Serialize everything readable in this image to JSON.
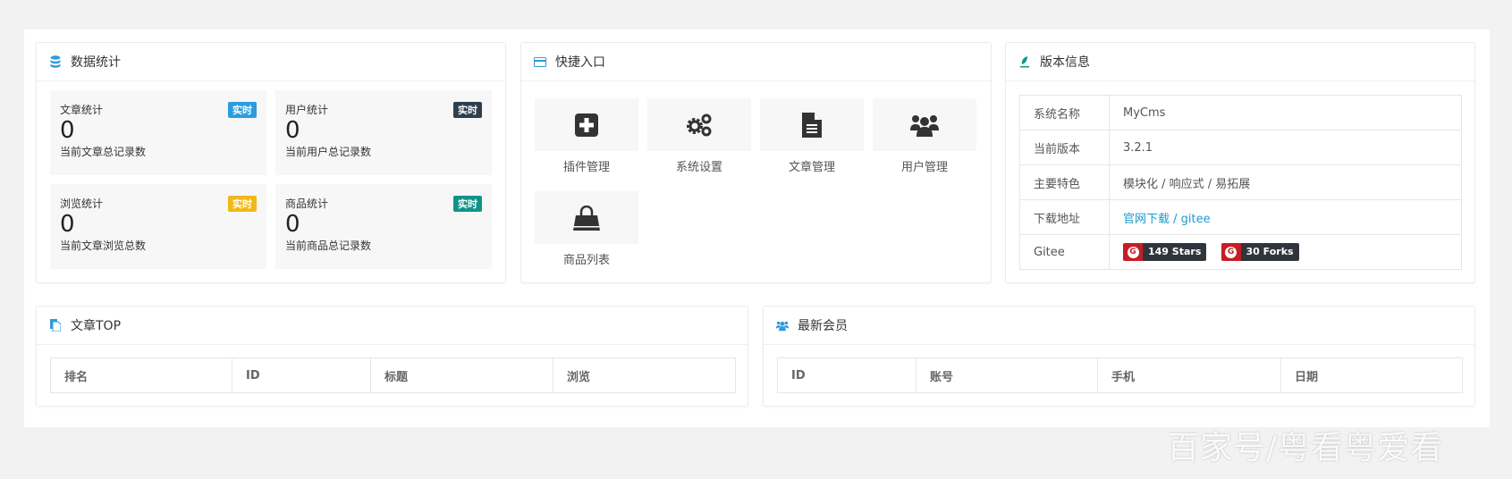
{
  "stats_card": {
    "title": "数据统计",
    "items": [
      {
        "title": "文章统计",
        "badge": "实时",
        "badge_color": "#2d9cdb",
        "value": "0",
        "desc": "当前文章总记录数"
      },
      {
        "title": "用户统计",
        "badge": "实时",
        "badge_color": "#2f3f50",
        "value": "0",
        "desc": "当前用户总记录数"
      },
      {
        "title": "浏览统计",
        "badge": "实时",
        "badge_color": "#f1b81a",
        "value": "0",
        "desc": "当前文章浏览总数"
      },
      {
        "title": "商品统计",
        "badge": "实时",
        "badge_color": "#119488",
        "value": "0",
        "desc": "当前商品总记录数"
      }
    ]
  },
  "quick_card": {
    "title": "快捷入口",
    "items": [
      {
        "label": "插件管理",
        "icon": "plus-square-icon"
      },
      {
        "label": "系统设置",
        "icon": "gears-icon"
      },
      {
        "label": "文章管理",
        "icon": "file-text-icon"
      },
      {
        "label": "用户管理",
        "icon": "users-icon"
      },
      {
        "label": "商品列表",
        "icon": "shopping-bag-icon"
      }
    ]
  },
  "version_card": {
    "title": "版本信息",
    "rows": [
      {
        "label": "系统名称",
        "value": "MyCms"
      },
      {
        "label": "当前版本",
        "value": "3.2.1"
      },
      {
        "label": "主要特色",
        "value": "模块化 / 响应式 / 易拓展"
      },
      {
        "label": "下载地址",
        "link1": "官网下载",
        "sep": " / ",
        "link2": "gitee"
      },
      {
        "label": "Gitee",
        "stars": "149 Stars",
        "forks": "30 Forks",
        "badge_logo": "G"
      }
    ]
  },
  "top_card": {
    "title": "文章TOP",
    "columns": [
      "排名",
      "ID",
      "标题",
      "浏览"
    ]
  },
  "members_card": {
    "title": "最新会员",
    "columns": [
      "ID",
      "账号",
      "手机",
      "日期"
    ]
  },
  "watermark": "百家号/粤看粤爱看"
}
